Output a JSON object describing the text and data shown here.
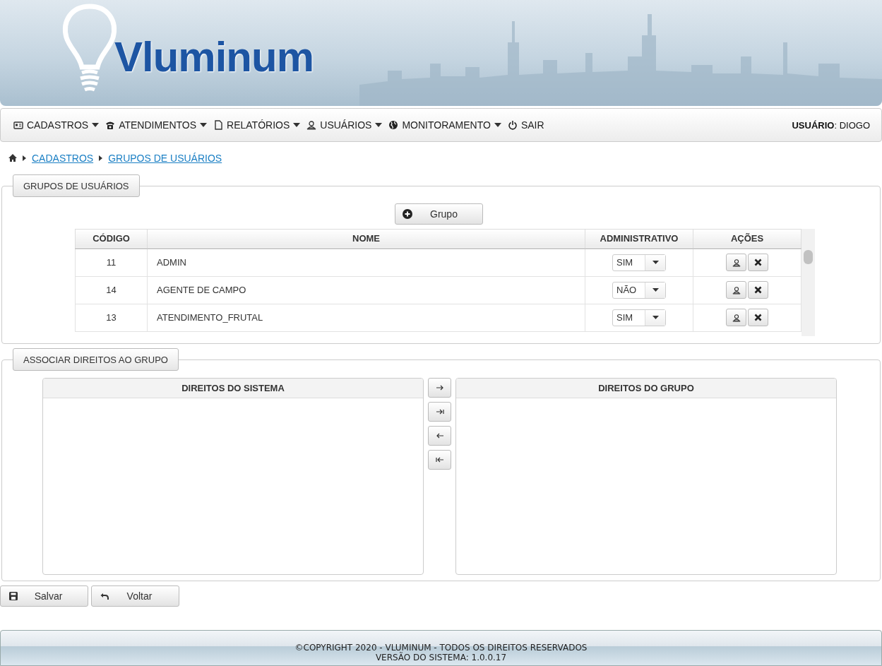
{
  "header": {
    "logo": "Vluminum"
  },
  "menu": [
    {
      "label": "CADASTROS",
      "dropdown": true
    },
    {
      "label": "ATENDIMENTOS",
      "dropdown": true
    },
    {
      "label": "RELATÓRIOS",
      "dropdown": true
    },
    {
      "label": "USUÁRIOS",
      "dropdown": true
    },
    {
      "label": "MONITORAMENTO",
      "dropdown": true
    },
    {
      "label": "SAIR",
      "dropdown": false
    }
  ],
  "user": "**USUÁRIO**: DIOGO",
  "breadcrumb": [
    "CADASTROS",
    "GRUPOS DE USUÁRIOS"
  ],
  "groups_panel": {
    "legend": "GRUPOS DE USUÁRIOS",
    "add_button": "Grupo",
    "columns": [
      "CÓDIGO",
      "NOME",
      "ADMINISTRATIVO",
      "AÇÕES"
    ],
    "rows": [
      {
        "code": "11",
        "name": "ADMIN",
        "admin": "SIM"
      },
      {
        "code": "14",
        "name": "AGENTE DE CAMPO",
        "admin": "NÃO"
      },
      {
        "code": "13",
        "name": "ATENDIMENTO_FRUTAL",
        "admin": "SIM"
      }
    ]
  },
  "rights_panel": {
    "legend": "ASSOCIAR DIREITOS AO GRUPO",
    "left_title": "DIREITOS DO SISTEMA",
    "right_title": "DIREITOS DO GRUPO"
  },
  "buttons": [
    "Salvar",
    "Voltar"
  ],
  "footer": [
    "©COPYRIGHT 2020 - VLUMINUM - TODOS OS DIREITOS RESERVADOS",
    "VERSÃO DO SISTEMA: 1.0.0.17"
  ]
}
